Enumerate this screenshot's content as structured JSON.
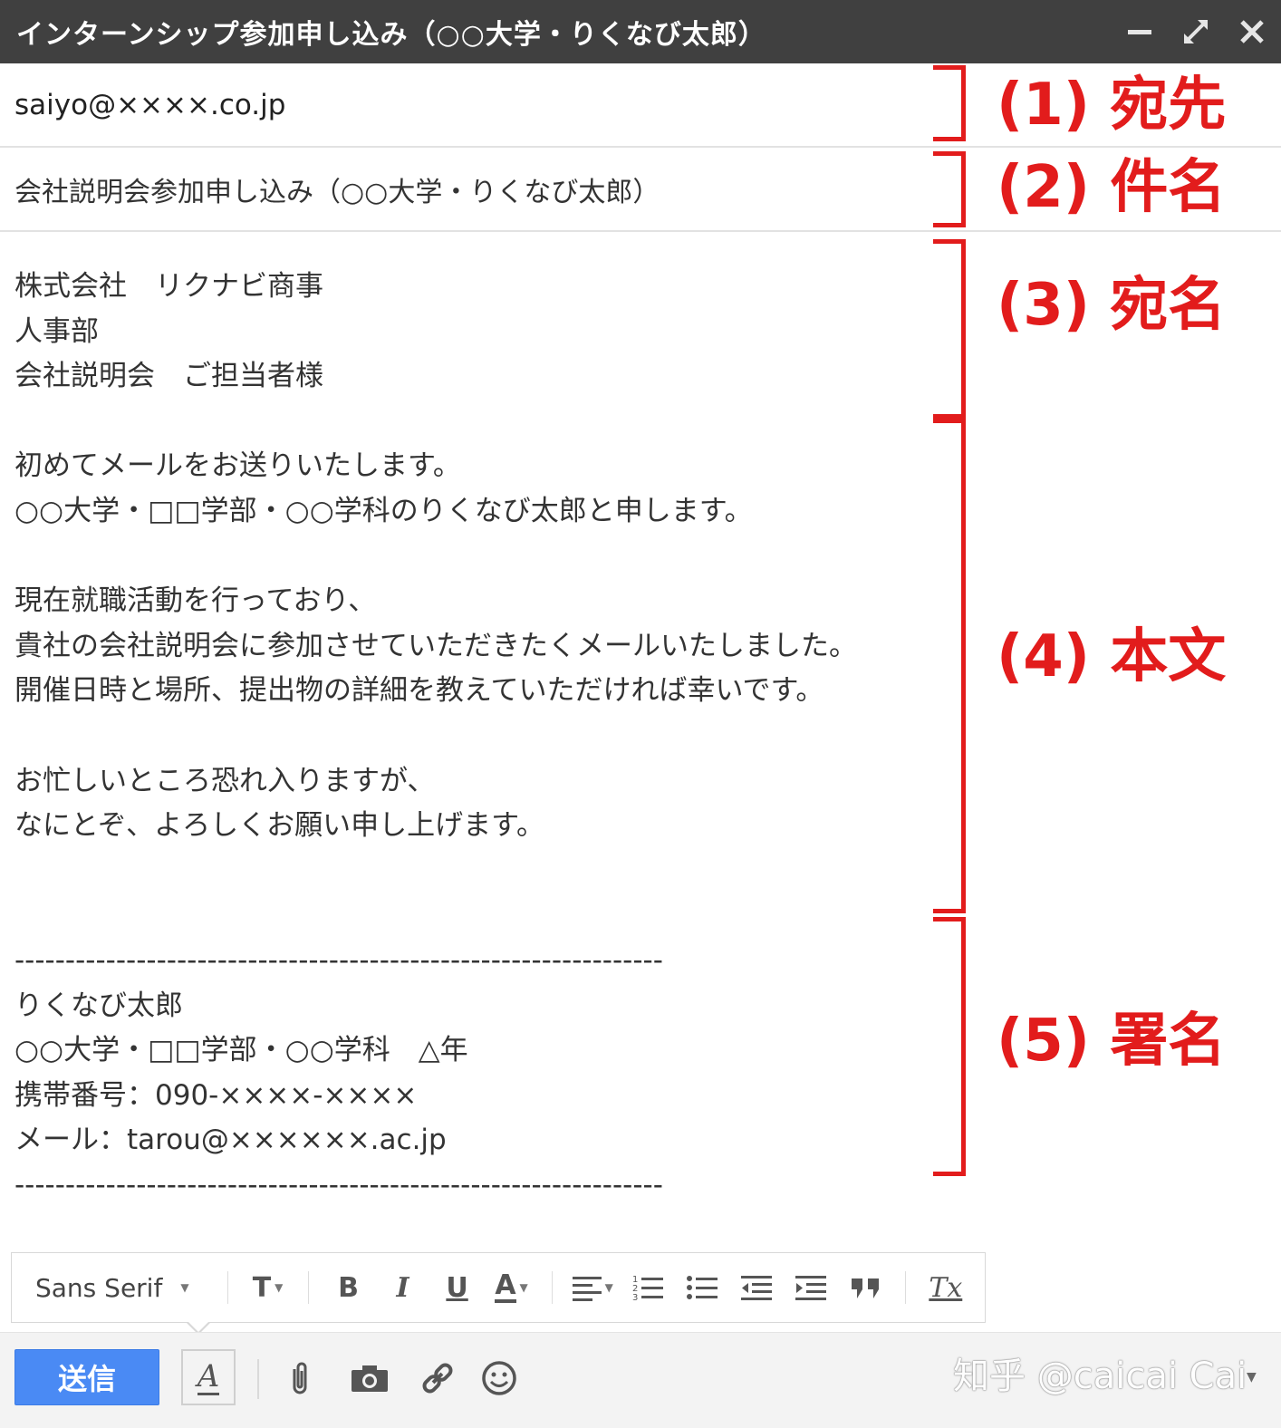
{
  "window": {
    "title": "インターンシップ参加申し込み（○○大学・りくなび太郎）",
    "controls": [
      "minimize-icon",
      "expand-icon",
      "close-icon"
    ]
  },
  "compose": {
    "to": "saiyo@××××.co.jp",
    "subject": "会社説明会参加申し込み（○○大学・りくなび太郎）",
    "body_lines": [
      "株式会社　リクナビ商事",
      "人事部",
      "会社説明会　ご担当者様",
      "",
      "初めてメールをお送りいたします。",
      "○○大学・□□学部・○○学科のりくなび太郎と申します。",
      "",
      "現在就職活動を行っており、",
      "貴社の会社説明会に参加させていただきたくメールいたしました。",
      "開催日時と場所、提出物の詳細を教えていただければ幸いです。",
      "",
      "お忙しいところ恐れ入りますが、",
      "なにとぞ、よろしくお願い申し上げます。",
      "",
      "",
      "----------------------------------------------------------------",
      "りくなび太郎",
      "○○大学・□□学部・○○学科　△年",
      "携帯番号：090-××××-××××",
      "メール：tarou@××××××.ac.jp",
      "----------------------------------------------------------------"
    ]
  },
  "annotations": {
    "a1": "(1)  宛先",
    "a2": "(2)  件名",
    "a3": "(3)  宛名",
    "a4": "(4)  本文",
    "a5": "(5)  署名",
    "color": "#e21c1c"
  },
  "format_toolbar": {
    "font": "Sans Serif",
    "text_size_label": "T",
    "bold_label": "B",
    "italic_label": "I",
    "underline_label": "U",
    "text_color_label": "A",
    "clear_format_label": "Tx"
  },
  "bottom_bar": {
    "send_label": "送信",
    "format_toggle_label": "A",
    "accent_color": "#4a8af4"
  },
  "watermark": "知乎 @caicai Cai"
}
